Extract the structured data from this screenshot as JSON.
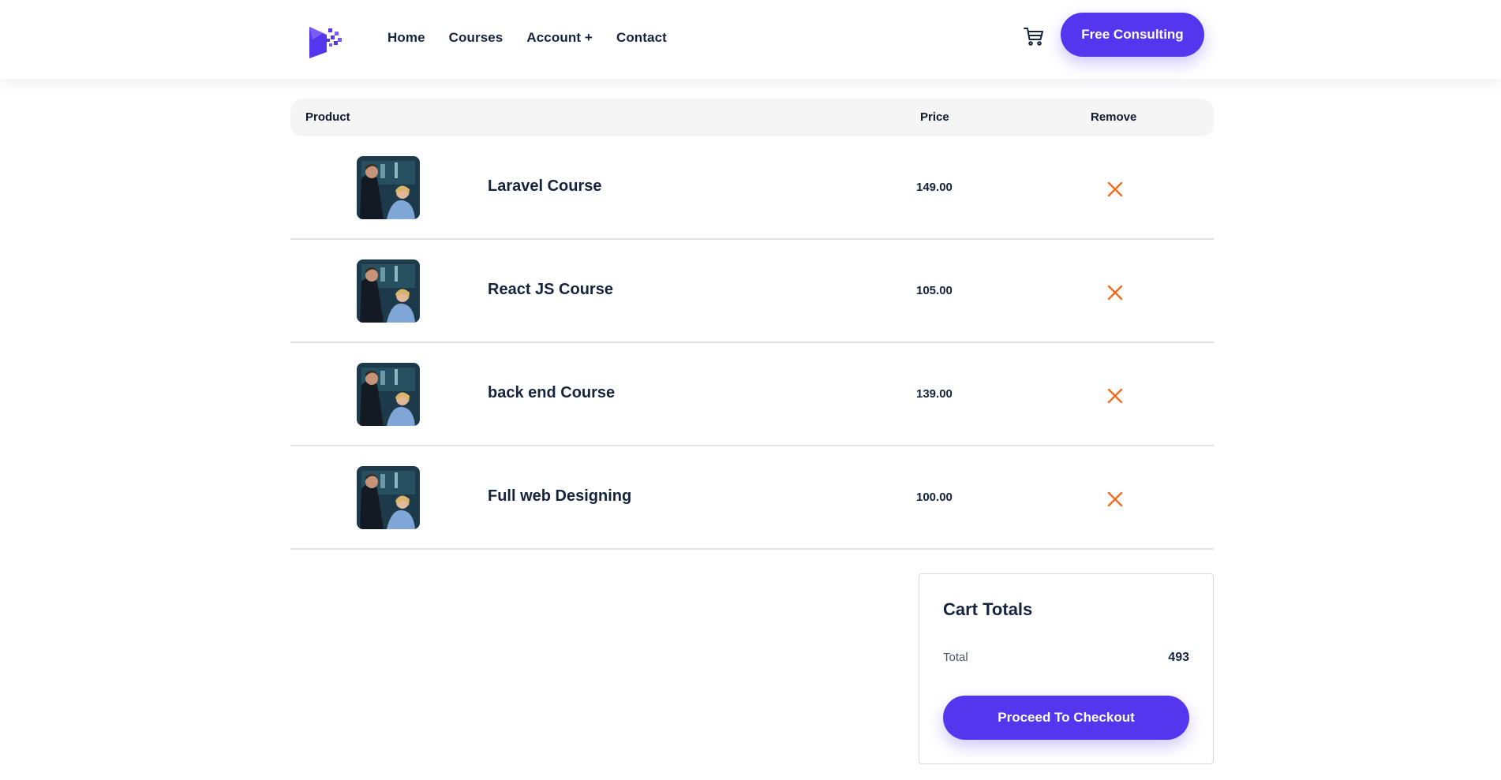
{
  "header": {
    "nav": [
      {
        "label": "Home"
      },
      {
        "label": "Courses"
      },
      {
        "label": "Account +"
      },
      {
        "label": "Contact"
      }
    ],
    "cta_label": "Free Consulting"
  },
  "table": {
    "headers": {
      "product": "Product",
      "price": "Price",
      "remove": "Remove"
    },
    "rows": [
      {
        "name": "Laravel Course",
        "price": "149.00"
      },
      {
        "name": "React JS Course",
        "price": "105.00"
      },
      {
        "name": "back end Course",
        "price": "139.00"
      },
      {
        "name": "Full web Designing",
        "price": "100.00"
      }
    ]
  },
  "totals": {
    "title": "Cart Totals",
    "total_label": "Total",
    "total_value": "493",
    "checkout_label": "Proceed To Checkout"
  },
  "colors": {
    "accent": "#5336ee",
    "remove": "#f36a1c"
  },
  "icons": {
    "cart": "shopping-cart-icon",
    "remove": "close-x-icon",
    "logo": "brand-logo"
  }
}
